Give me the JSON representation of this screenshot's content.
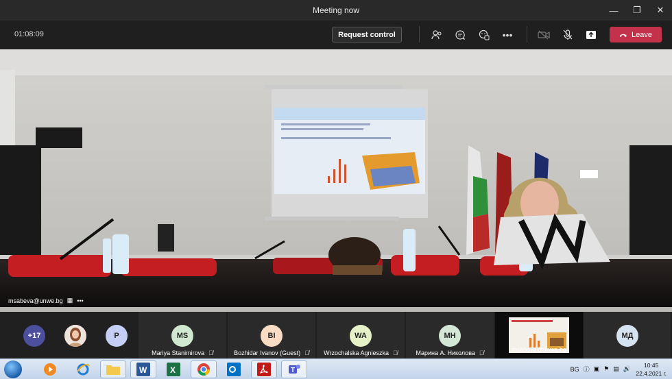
{
  "window": {
    "title": "Meeting now",
    "controls": [
      "minimize-icon",
      "restore-icon",
      "close-icon"
    ]
  },
  "toolbar": {
    "timer": "01:08:09",
    "request_control_label": "Request control",
    "leave_label": "Leave",
    "icons": [
      "participants-icon",
      "chat-icon",
      "reactions-icon",
      "more-options-icon",
      "camera-off-icon",
      "mic-off-icon",
      "share-screen-icon"
    ]
  },
  "main_video": {
    "owner": "msabeva@unwe.bg"
  },
  "participants": [
    {
      "kind": "count",
      "label": "+17",
      "color": "#4b4f9c"
    },
    {
      "kind": "photo",
      "label": "",
      "color": "#d9c3b6"
    },
    {
      "kind": "initials",
      "initials": "P",
      "color": "#c5cef4"
    },
    {
      "kind": "named",
      "initials": "MS",
      "name": "Mariya Stanimirova",
      "color": "#cfe8cf"
    },
    {
      "kind": "named",
      "initials": "BI",
      "name": "Bozhidar Ivanov (Guest)",
      "color": "#f9dcc4"
    },
    {
      "kind": "named",
      "initials": "WA",
      "name": "Wrzochalska Agnieszka",
      "color": "#e6f1c7"
    },
    {
      "kind": "named",
      "initials": "МН",
      "name": "Марина А. Николова",
      "color": "#d4e6d6"
    },
    {
      "kind": "screen",
      "name": "msabeva@unwe.bg"
    },
    {
      "kind": "named",
      "initials": "МД",
      "name": "",
      "color": "#d5e2ef"
    }
  ],
  "taskbar": {
    "apps": [
      "media-player-icon",
      "internet-explorer-icon",
      "file-explorer-icon",
      "word-icon",
      "excel-icon",
      "chrome-icon",
      "outlook-icon",
      "acrobat-icon",
      "teams-icon"
    ],
    "language": "BG",
    "time": "10:45",
    "date": "22.4.2021 г."
  }
}
